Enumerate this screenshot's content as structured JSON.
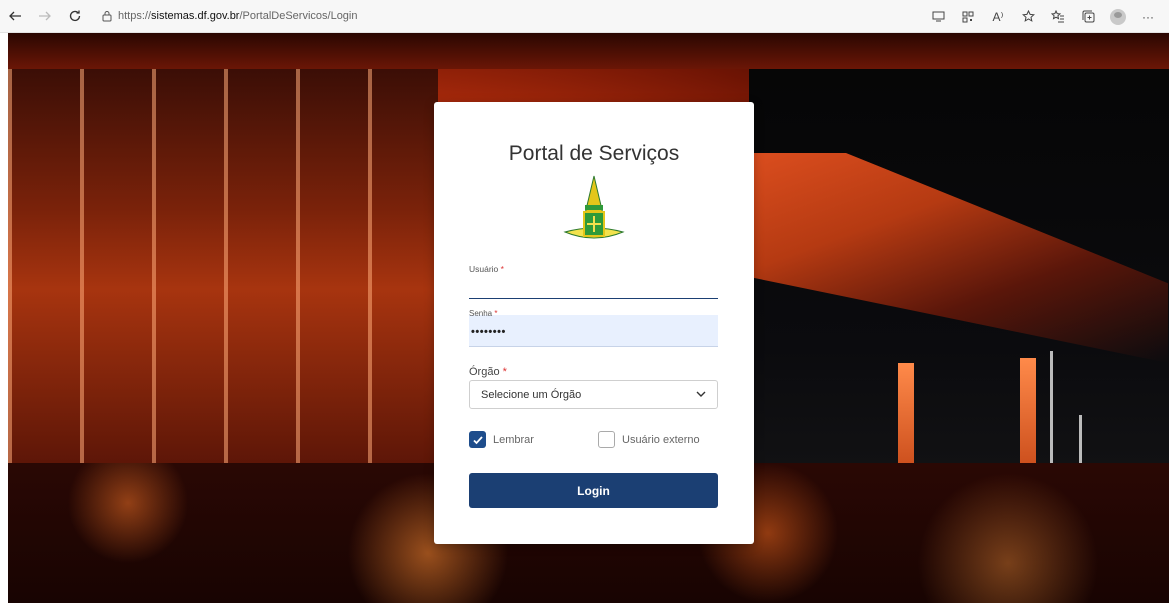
{
  "browser": {
    "url_prefix": "https://",
    "url_domain": "sistemas.df.gov.br",
    "url_path": "/PortalDeServicos/Login",
    "read_aloud_label": "A⁾",
    "more_label": "···"
  },
  "login": {
    "title": "Portal de Serviços",
    "usuario_label": "Usuário",
    "senha_label": "Senha",
    "senha_value": "••••••••",
    "orgao_label": "Órgão",
    "required_mark": "*",
    "orgao_placeholder": "Selecione um Órgão",
    "lembrar_label": "Lembrar",
    "lembrar_checked": true,
    "externo_label": "Usuário externo",
    "externo_checked": false,
    "login_button": "Login"
  },
  "colors": {
    "primary": "#1b3f73",
    "required": "#dd3333",
    "autofill": "#e8f0fe"
  }
}
